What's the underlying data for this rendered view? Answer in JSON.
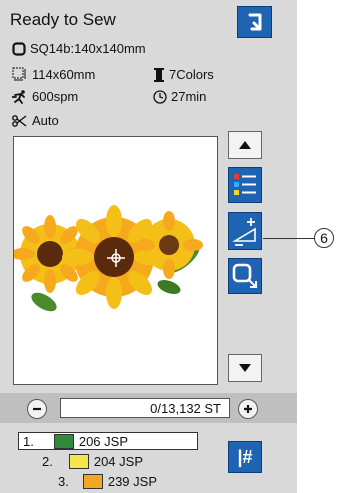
{
  "header": {
    "title": "Ready to Sew"
  },
  "info": {
    "hoop": "SQ14b:140x140mm",
    "size": "114x60mm",
    "colors": "7Colors",
    "speed": "600spm",
    "time": "27min",
    "thread_cutter": "Auto"
  },
  "counter": {
    "value": "0/13,132 ST"
  },
  "color_list": [
    {
      "index": "1.",
      "swatch": "#2e8b3a",
      "code": "206 JSP"
    },
    {
      "index": "2.",
      "swatch": "#f2e64a",
      "code": "204 JSP"
    },
    {
      "index": "3.",
      "swatch": "#f3a623",
      "code": "239 JSP"
    }
  ],
  "hash_button": {
    "label": "|#"
  },
  "callout": {
    "label": "6"
  }
}
